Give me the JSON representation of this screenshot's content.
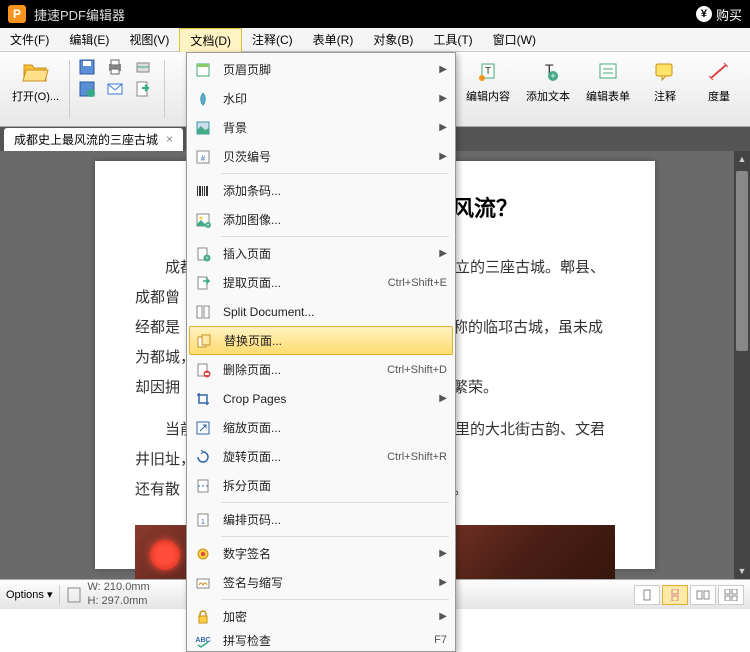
{
  "app": {
    "title": "捷速PDF编辑器",
    "buy": "购买"
  },
  "menubar": [
    {
      "label": "文件(F)"
    },
    {
      "label": "编辑(E)"
    },
    {
      "label": "视图(V)"
    },
    {
      "label": "文档(D)",
      "active": true
    },
    {
      "label": "注释(C)"
    },
    {
      "label": "表单(R)"
    },
    {
      "label": "对象(B)"
    },
    {
      "label": "工具(T)"
    },
    {
      "label": "窗口(W)"
    }
  ],
  "ribbon": {
    "open": "打开(O)...",
    "right": [
      {
        "label": "编辑内容"
      },
      {
        "label": "添加文本"
      },
      {
        "label": "编辑表单"
      },
      {
        "label": "注释"
      },
      {
        "label": "度量"
      }
    ]
  },
  "tab": {
    "title": "成都史上最风流的三座古城",
    "close": "×"
  },
  "document": {
    "heading_suffix": "哪个最风流？",
    "p1_a": "成都城",
    "p1_b": "建立的三座古城。郫县、成都曾",
    "p2_a": "经都是",
    "p2_b": "之称的临邛古城，虽未成为都城，",
    "p3_a": "却因拥",
    "p3_b": "扬繁荣。",
    "p4_a": "当前两",
    "p4_b": "城里的大北街古韵、文君井旧址，",
    "p5_a": "还有散",
    "p5_b": "迹。"
  },
  "dropdown": [
    {
      "icon": "header-footer",
      "label": "页眉页脚",
      "submenu": true
    },
    {
      "icon": "watermark",
      "label": "水印",
      "submenu": true
    },
    {
      "icon": "background",
      "label": "背景",
      "submenu": true
    },
    {
      "icon": "bates",
      "label": "贝茨编号",
      "submenu": true
    },
    {
      "divider": true
    },
    {
      "icon": "barcode",
      "label": "添加条码..."
    },
    {
      "icon": "image",
      "label": "添加图像..."
    },
    {
      "divider": true
    },
    {
      "icon": "insert-page",
      "label": "插入页面",
      "submenu": true
    },
    {
      "icon": "extract-page",
      "label": "提取页面...",
      "shortcut": "Ctrl+Shift+E"
    },
    {
      "icon": "split",
      "label": "Split Document..."
    },
    {
      "icon": "replace-page",
      "label": "替换页面...",
      "highlight": true
    },
    {
      "icon": "delete-page",
      "label": "删除页面...",
      "shortcut": "Ctrl+Shift+D"
    },
    {
      "icon": "crop",
      "label": "Crop Pages",
      "submenu": true
    },
    {
      "icon": "resize",
      "label": "缩放页面..."
    },
    {
      "icon": "rotate",
      "label": "旋转页面...",
      "shortcut": "Ctrl+Shift+R"
    },
    {
      "icon": "split-page",
      "label": "拆分页面"
    },
    {
      "divider": true
    },
    {
      "icon": "number-pages",
      "label": "编排页码..."
    },
    {
      "divider": true
    },
    {
      "icon": "sign",
      "label": "数字签名",
      "submenu": true
    },
    {
      "icon": "initials",
      "label": "签名与缩写",
      "submenu": true
    },
    {
      "divider": true
    },
    {
      "icon": "encrypt",
      "label": "加密",
      "submenu": true
    },
    {
      "icon": "spell",
      "label": "拼写检查",
      "shortcut": "F7",
      "cut": true
    }
  ],
  "statusbar": {
    "options": "Options",
    "width": "W: 210.0mm",
    "height": "H: 297.0mm"
  }
}
